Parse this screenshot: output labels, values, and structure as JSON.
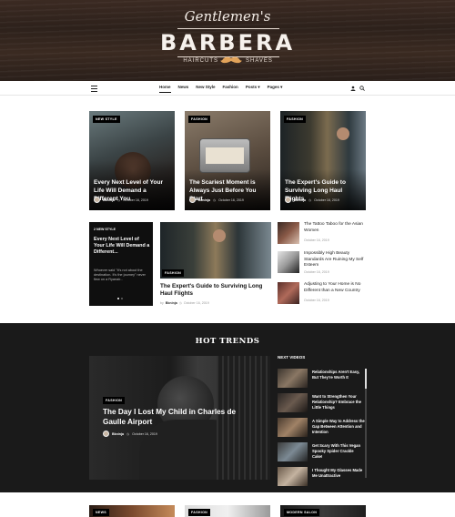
{
  "header": {
    "logo_script": "Gentlemen's",
    "logo_main": "BARBERA",
    "logo_left": "HAIRCUTS",
    "logo_right": "SHAVES"
  },
  "nav": {
    "items": [
      "Home",
      "News",
      "New Style",
      "Fashion",
      "Posts",
      "Pages"
    ],
    "posts_arrow": "▾",
    "pages_arrow": "▾"
  },
  "featured": [
    {
      "badge": "NEW STYLE",
      "title": "Every Next Level of Your Life Will Demand a Different You",
      "author": "Bkninja",
      "date": "October 16, 2019"
    },
    {
      "badge": "FASHION",
      "title": "The Scariest Moment is Always Just Before You Start",
      "author": "Bkninja",
      "date": "October 16, 2019"
    },
    {
      "badge": "FASHION",
      "title": "The Expert's Guide to Surviving Long Haul Flights",
      "author": "Bkninja",
      "date": "October 16, 2019"
    }
  ],
  "slider": {
    "badge": "NEW STYLE",
    "num": "2",
    "title": "Every Next Level of Your Life Will Demand a Different...",
    "excerpt": "Whoever said \"It's not about the destination. It's the journey\" never flew on a Ryanair..."
  },
  "middle": {
    "badge": "FASHION",
    "title": "The Expert's Guide to Surviving Long Haul Flights",
    "by": "by",
    "author": "Bkninja",
    "date": "October 16, 2019"
  },
  "side_list": [
    {
      "title": "The Tattoo Taboo for the Asian Women",
      "date": "October 16, 2019"
    },
    {
      "title": "Impossibly High Beauty Standards Are Ruining My Self Esteem",
      "date": "October 16, 2019"
    },
    {
      "title": "Adjusting to Your Home is No Different than a New Country",
      "date": "October 16, 2019"
    }
  ],
  "hot_trends": {
    "title": "HOT TRENDS",
    "badge": "FASHION",
    "main_title": "The Day I Lost My Child in Charles de Gaulle Airport",
    "author": "Bkninja",
    "date": "October 16, 2019",
    "next_title": "NEXT VIDEOS",
    "next_videos": [
      "Relationships Aren't Easy, But They're Worth It",
      "Want to Strengthen Your Relationship? Embrace the Little Things",
      "A Simple Way to Address the Gap Between Attention and Intention",
      "Get Scary With This Vegan Spooky Spider Crackle Cake!",
      "I Thought My Glasses Made Me Unattractive"
    ]
  },
  "bottom_badges": [
    "NEWS",
    "FASHION",
    "MODERN SALON"
  ]
}
